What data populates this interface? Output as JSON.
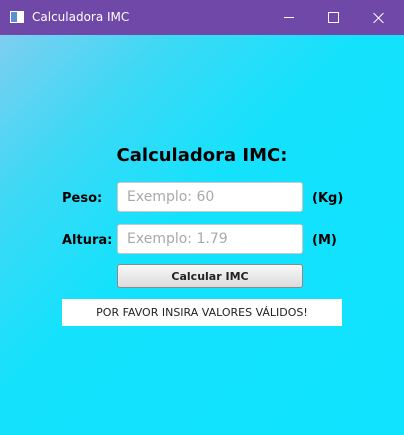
{
  "window": {
    "title": "Calculadora IMC",
    "accent": "#7048a8",
    "background": "#00e5ff"
  },
  "icons": {
    "app": "app-window-icon",
    "minimize": "minimize-icon",
    "maximize": "maximize-icon",
    "close": "close-icon"
  },
  "form": {
    "heading": "Calculadora IMC:",
    "weight": {
      "label": "Peso:",
      "placeholder": "Exemplo: 60",
      "value": "",
      "unit": "(Kg)"
    },
    "height": {
      "label": "Altura:",
      "placeholder": "Exemplo: 1.79",
      "value": "",
      "unit": "(M)"
    },
    "calculate_label": "Calcular IMC",
    "status_message": "POR FAVOR INSIRA VALORES VÁLIDOS!"
  }
}
